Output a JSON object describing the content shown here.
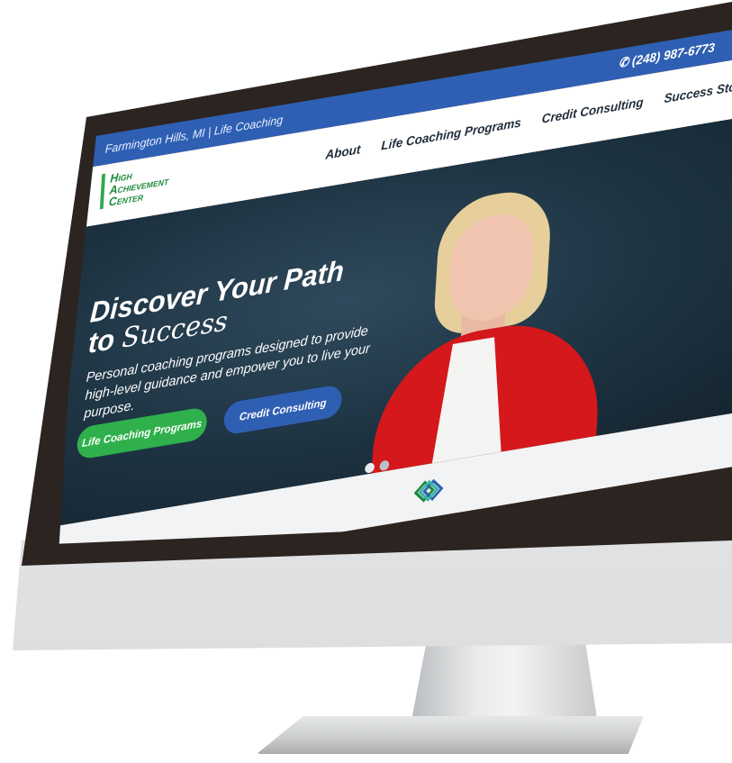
{
  "topbar": {
    "location": "Farmington Hills, MI | Life Coaching",
    "phone": "(248) 987-6773"
  },
  "logo": {
    "line1": "High",
    "line2": "Achievement",
    "line3": "Center"
  },
  "nav": {
    "items": [
      "About",
      "Life Coaching Programs",
      "Credit Consulting",
      "Success Stor"
    ]
  },
  "hero": {
    "title_line1": "Discover Your Path",
    "title_line2_prefix": "to ",
    "title_line2_script": "Success",
    "subtitle": "Personal coaching programs designed to provide high-level guidance and empower you to live your purpose.",
    "btn_primary": "Life Coaching Programs",
    "btn_secondary": "Credit Consulting"
  },
  "colors": {
    "topbar": "#2f5fb3",
    "brand_green": "#2fb04c",
    "brand_blue": "#2f5fb3",
    "hero_bg": "#1d3342"
  },
  "icons": {
    "phone": "phone-icon",
    "diamond": "diamond-logo-icon"
  }
}
